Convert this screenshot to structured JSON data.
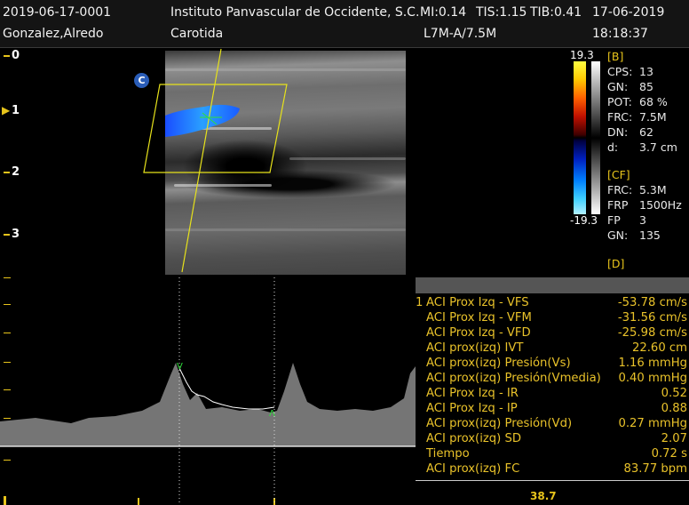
{
  "header": {
    "patient_id": "2019-06-17-0001",
    "patient_name": "Gonzalez,Alredo",
    "institution": "Instituto Panvascular de Occidente, S.C.",
    "mi": "MI:0.14",
    "tis": "TIS:1.15",
    "tib": "TIB:0.41",
    "date": "17-06-2019",
    "exam": "Carotida",
    "probe": "L7M-A/7.5M",
    "time": "18:18:37"
  },
  "depth_scale": {
    "labels": [
      "0",
      "1",
      "2",
      "3"
    ]
  },
  "color_mode_badge": "C",
  "color_scale": {
    "max": "19.3",
    "min": "-19.3"
  },
  "params": {
    "b_title": "[B]",
    "b": [
      {
        "k": "CPS:",
        "v": "13"
      },
      {
        "k": "GN:",
        "v": "85"
      },
      {
        "k": "POT:",
        "v": "68 %"
      },
      {
        "k": "FRC:",
        "v": "7.5M"
      },
      {
        "k": "DN:",
        "v": "62"
      },
      {
        "k": "d:",
        "v": "3.7 cm"
      }
    ],
    "cf_title": "[CF]",
    "cf": [
      {
        "k": "FRC:",
        "v": "5.3M"
      },
      {
        "k": "FRP",
        "v": "1500Hz"
      },
      {
        "k": "FP",
        "v": "3"
      },
      {
        "k": "GN:",
        "v": "135"
      }
    ],
    "d_title": "[D]"
  },
  "measurements": [
    {
      "idx": "1",
      "label": "ACI Prox Izq - VFS",
      "value": "-53.78 cm/s"
    },
    {
      "idx": "",
      "label": "ACI Prox Izq - VFM",
      "value": "-31.56 cm/s"
    },
    {
      "idx": "",
      "label": "ACI Prox Izq - VFD",
      "value": "-25.98 cm/s"
    },
    {
      "idx": "",
      "label": "ACI prox(izq) IVT",
      "value": "22.60 cm"
    },
    {
      "idx": "",
      "label": "ACI prox(izq) Presión(Vs)",
      "value": "1.16 mmHg"
    },
    {
      "idx": "",
      "label": "ACI prox(izq) Presión(Vmedia)",
      "value": "0.40 mmHg"
    },
    {
      "idx": "",
      "label": "ACI Prox Izq - IR",
      "value": "0.52"
    },
    {
      "idx": "",
      "label": "ACI Prox Izq - IP",
      "value": "0.88"
    },
    {
      "idx": "",
      "label": "ACI prox(izq) Presión(Vd)",
      "value": "0.27 mmHg"
    },
    {
      "idx": "",
      "label": "ACI prox(izq) SD",
      "value": "2.07"
    },
    {
      "idx": "",
      "label": "Tiempo",
      "value": "0.72 s"
    },
    {
      "idx": "",
      "label": "ACI prox(izq) FC",
      "value": "83.77 bpm"
    }
  ],
  "bottom_readout": "38.7",
  "colors": {
    "accent": "#e7c41b",
    "doppler_red": "#d0301e",
    "doppler_blue": "#1a5cff"
  }
}
